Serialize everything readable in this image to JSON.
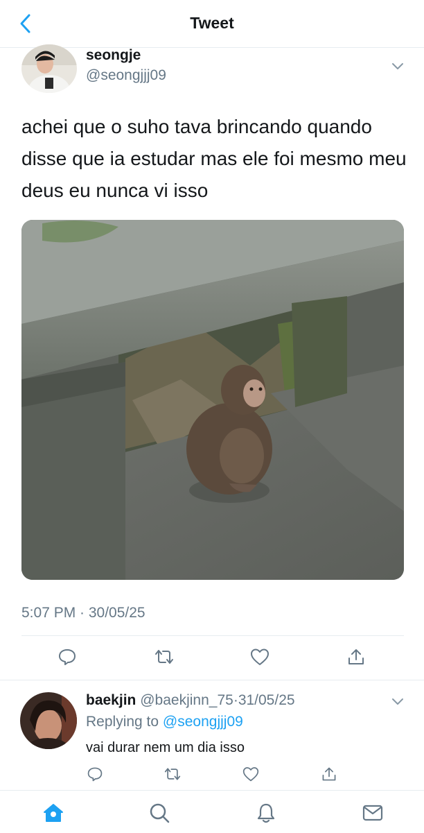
{
  "header": {
    "title": "Tweet",
    "back_icon": "chevron-left-icon",
    "accent": "#1da1f2"
  },
  "tweet": {
    "name": "seongje",
    "handle": "@seongjjj09",
    "text": "achei que o suho tava brincando quando disse que ia estudar mas ele foi mesmo meu deus eu nunca vi isso",
    "timestamp": "5:07 PM · 30/05/25",
    "media_icon": "monkey-photo",
    "actions": [
      "reply-icon",
      "retweet-icon",
      "like-icon",
      "share-icon"
    ]
  },
  "reply": {
    "name": "baekjin",
    "handle": "@baekjinn_75",
    "date": "31/05/25",
    "dot": "·",
    "replying_label": "Replying to",
    "replying_handle": "@seongjjj09",
    "text": "vai durar nem um dia isso"
  },
  "tabbar": {
    "items": [
      "home-icon",
      "search-icon",
      "notifications-icon",
      "messages-icon"
    ]
  }
}
